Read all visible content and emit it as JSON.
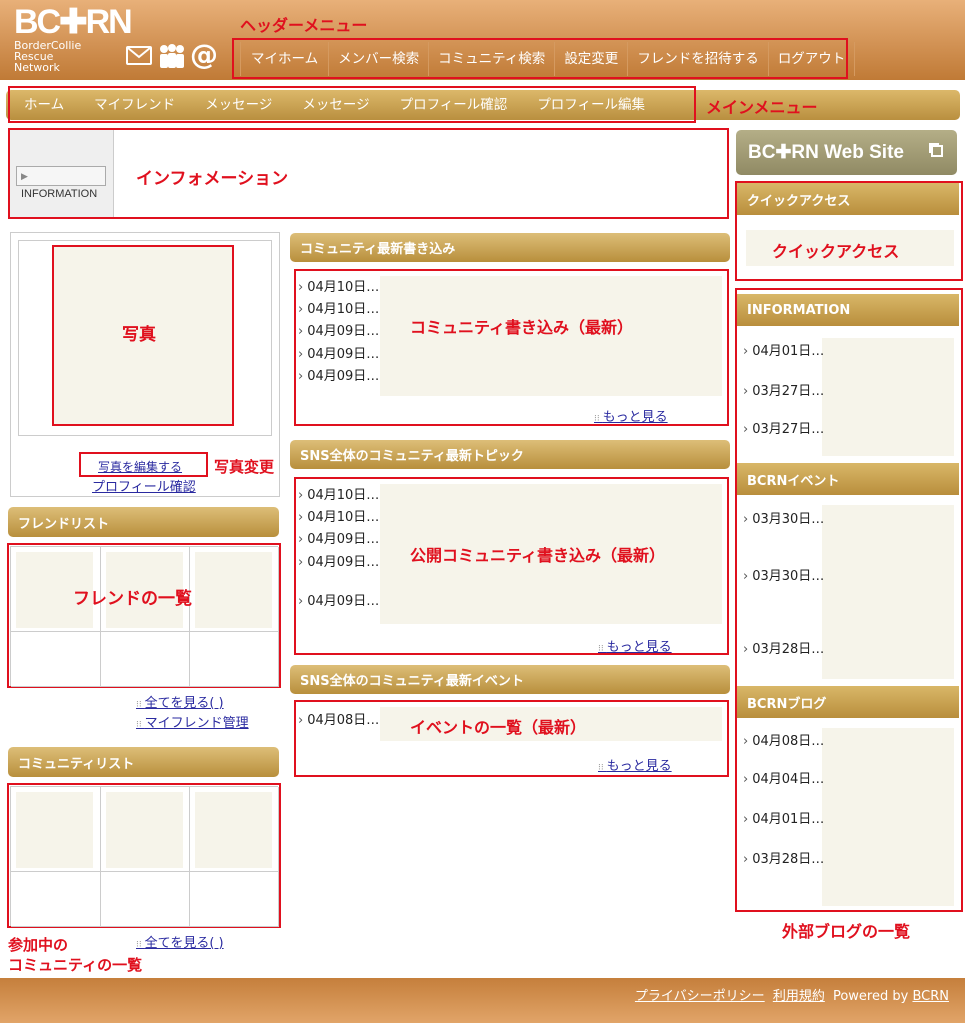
{
  "brand": {
    "logo": "BC✚RN",
    "logo_sub": [
      "BorderCollie",
      "Rescue",
      "Network"
    ]
  },
  "annotations": {
    "header_menu": "ヘッダーメニュー",
    "main_menu": "メインメニュー",
    "information": "インフォメーション",
    "photo": "写真",
    "photo_change": "写真変更",
    "friend_list": "フレンドの一覧",
    "community_list": [
      "参加中の",
      "コミュニティの一覧"
    ],
    "quick_access_title": "クイックアクセス",
    "quick_access": "クイックアクセス",
    "community_posts": "コミュニティ書き込み（最新）",
    "public_posts": "公開コミュニティ書き込み（最新）",
    "event_list": "イベントの一覧（最新）",
    "external_blog": "外部ブログの一覧"
  },
  "header_menu": [
    "マイホーム",
    "メンバー検索",
    "コミュニティ検索",
    "設定変更",
    "フレンドを招待する",
    "ログアウト"
  ],
  "main_menu": [
    "ホーム",
    "マイフレンド",
    "メッセージ",
    "メッセージ",
    "プロフィール確認",
    "プロフィール編集"
  ],
  "info_tag": "INFORMATION",
  "left": {
    "edit_photo": "写真を編集する",
    "profile_check": "プロフィール確認",
    "friend_list_title": "フレンドリスト",
    "see_all": "全てを見る( )",
    "manage_friends": "マイフレンド管理",
    "community_list_title": "コミュニティリスト",
    "see_all2": "全てを見る( )"
  },
  "center": {
    "sec1": {
      "title": "コミュニティ最新書き込み",
      "dates": [
        "04月10日…",
        "04月10日…",
        "04月09日…",
        "04月09日…",
        "04月09日…"
      ],
      "more": "もっと見る"
    },
    "sec2": {
      "title": "SNS全体のコミュニティ最新トピック",
      "dates": [
        "04月10日…",
        "04月10日…",
        "04月09日…",
        "04月09日…",
        "04月09日…"
      ],
      "more": "もっと見る"
    },
    "sec3": {
      "title": "SNS全体のコミュニティ最新イベント",
      "dates": [
        "04月08日…"
      ],
      "more": "もっと見る"
    }
  },
  "right": {
    "website": "BC✚RN Web Site",
    "info_title": "INFORMATION",
    "info_dates": [
      "04月01日…",
      "03月27日…",
      "03月27日…"
    ],
    "event_title": "BCRNイベント",
    "event_dates": [
      "03月30日…",
      "03月30日…",
      "03月28日…"
    ],
    "blog_title": "BCRNブログ",
    "blog_dates": [
      "04月08日…",
      "04月04日…",
      "04月01日…",
      "03月28日…"
    ]
  },
  "footer": {
    "privacy": "プライバシーポリシー",
    "terms": "利用規約",
    "powered": "Powered by",
    "bcrn": "BCRN"
  }
}
